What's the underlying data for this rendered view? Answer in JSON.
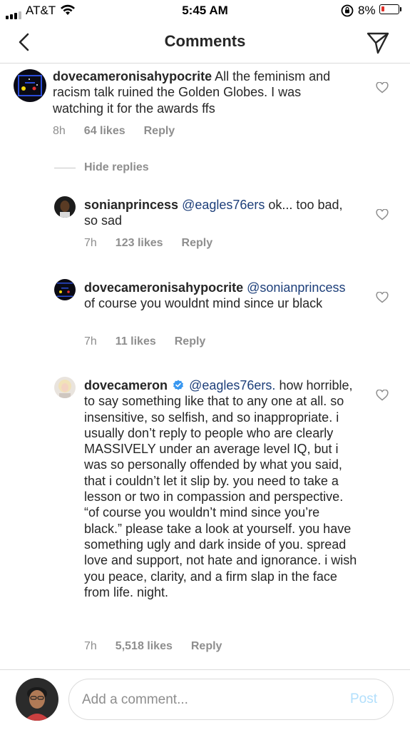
{
  "status_bar": {
    "carrier": "AT&T",
    "time": "5:45 AM",
    "battery": "8%",
    "battery_color": "#e0302a"
  },
  "header": {
    "title": "Comments",
    "back_icon": "chevron-left-icon",
    "send_icon": "paper-plane-icon"
  },
  "hide_replies": "Hide replies",
  "comments": [
    {
      "username": "dovecameronisahypocrite",
      "mention": "",
      "text": "All the feminism and racism talk ruined the Golden Globes. I was watching it for the awards ffs",
      "time": "8h",
      "likes": "64 likes",
      "reply": "Reply"
    },
    {
      "username": "sonianprincess",
      "mention": "@eagles76ers",
      "text": "ok... too bad, so sad",
      "time": "7h",
      "likes": "123 likes",
      "reply": "Reply"
    },
    {
      "username": "dovecameronisahypocrite",
      "mention": "@sonianprincess",
      "text": "of course you wouldnt mind since ur black",
      "time": "7h",
      "likes": "11 likes",
      "reply": "Reply"
    },
    {
      "username": "dovecameron",
      "verified": true,
      "mention": "@eagles76ers.",
      "text": "how horrible, to say something like that to any one at all. so insensitive, so selfish, and so inappropriate. i usually don’t reply to people who are clearly MASSIVELY under an average level IQ, but i was so personally offended by what you said, that i couldn’t let it slip by. you need to take a lesson or two in compassion and perspective. “of course you wouldn’t mind since you’re black.” please take a look at yourself. you have something ugly and dark inside of you. spread love and support, not hate and ignorance. i wish you peace, clarity, and a firm slap in the face from life. night.",
      "time": "7h",
      "likes": "5,518 likes",
      "reply": "Reply"
    }
  ],
  "composer": {
    "placeholder": "Add a comment...",
    "post_label": "Post",
    "post_color": "#b2dffc"
  },
  "colors": {
    "mention": "#1d3f7a",
    "meta": "#8e8e8e",
    "divider": "#dbdbdb"
  }
}
